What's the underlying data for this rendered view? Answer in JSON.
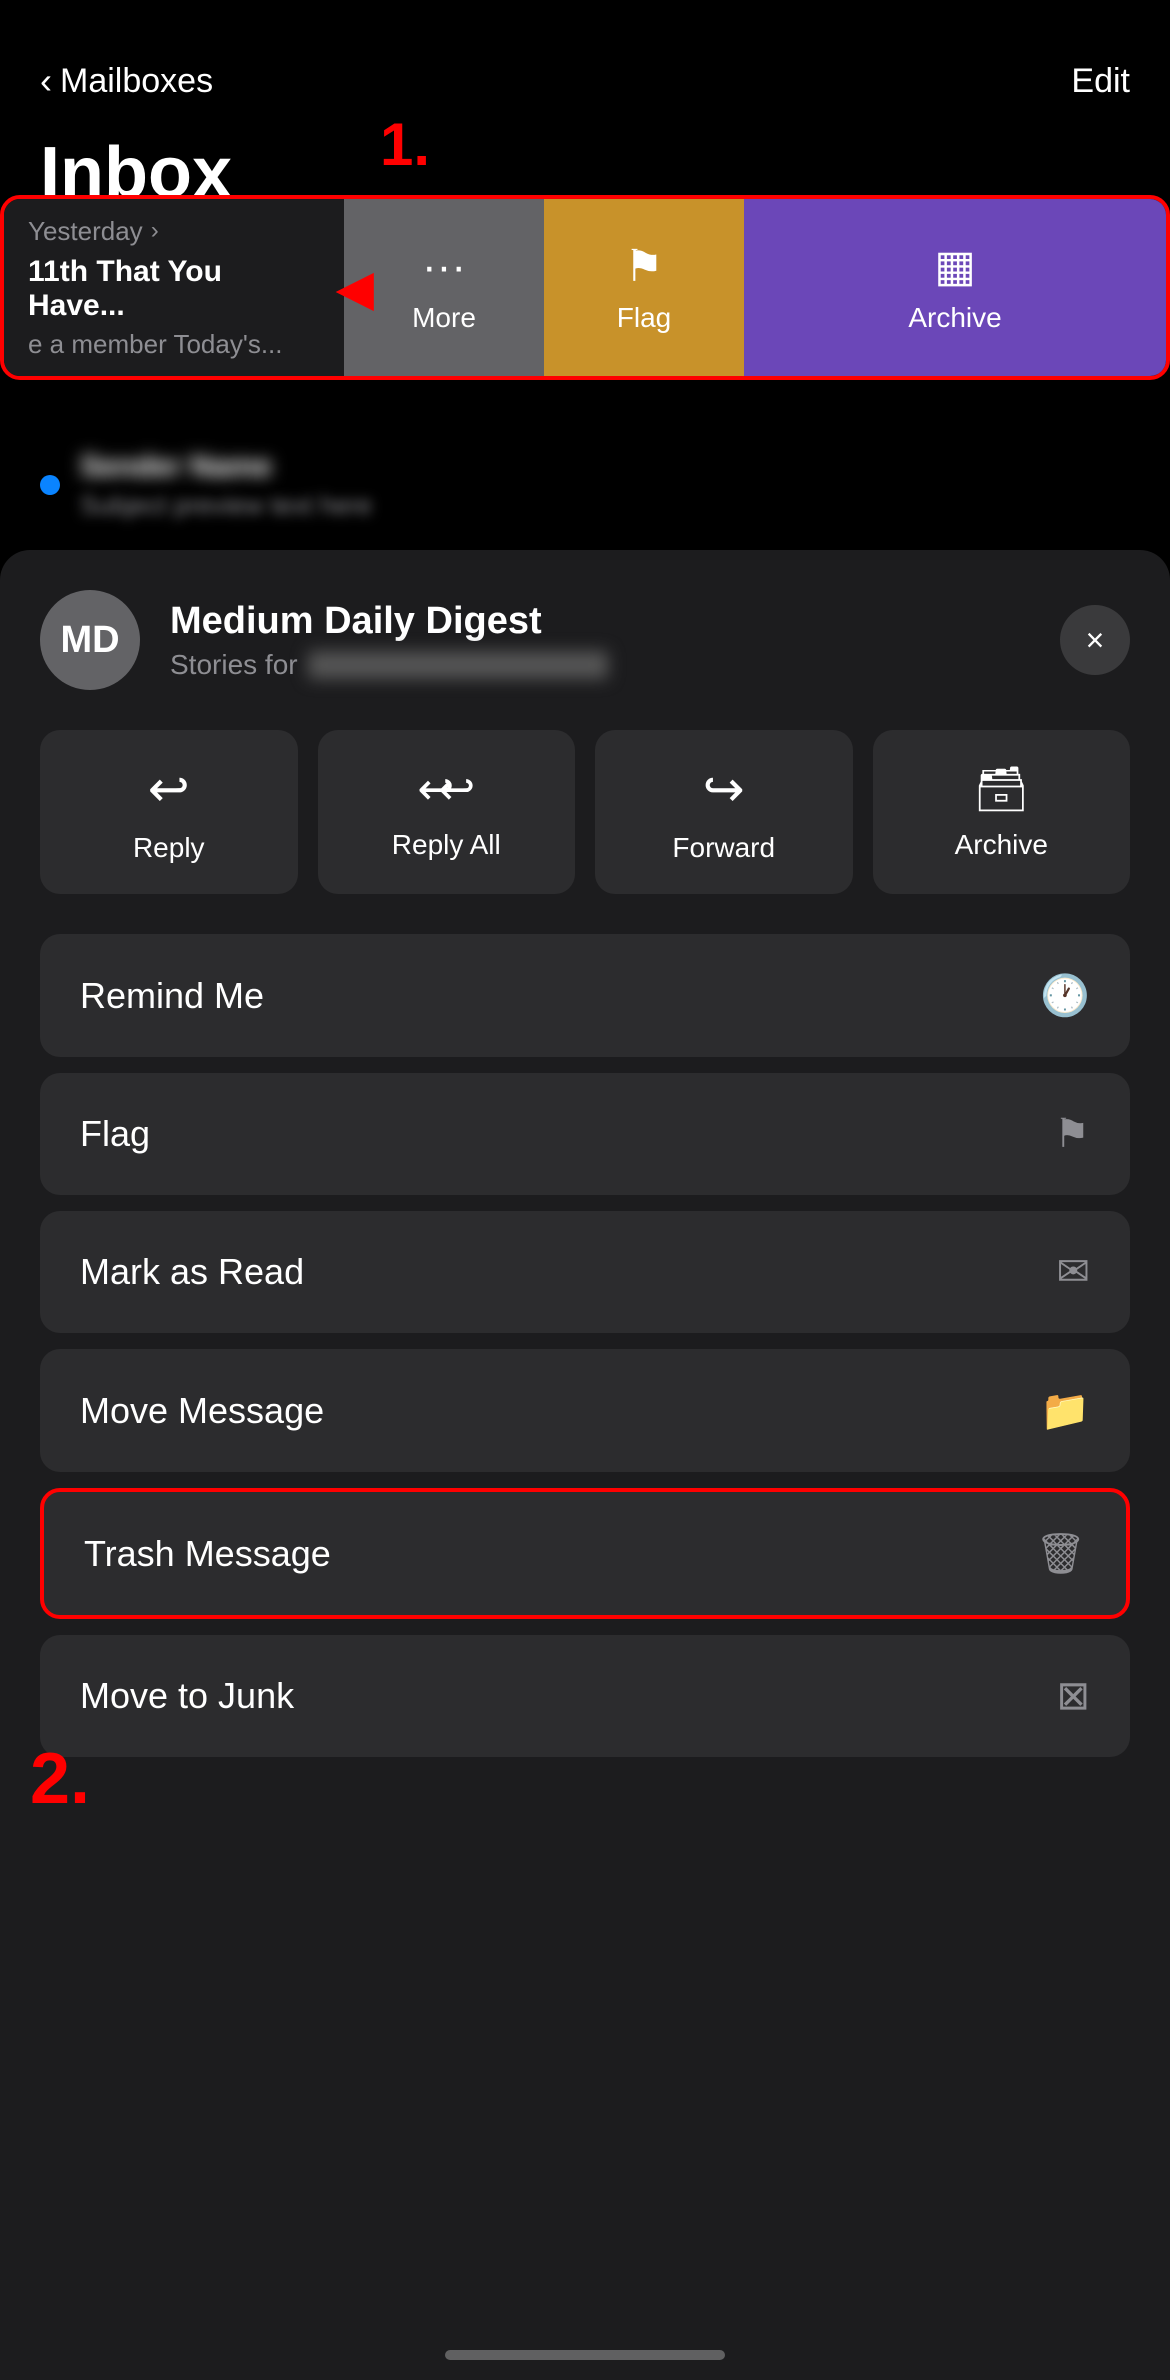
{
  "nav": {
    "back_label": "Mailboxes",
    "edit_label": "Edit"
  },
  "inbox": {
    "title": "Inbox"
  },
  "step1": "1.",
  "step2": "2.",
  "email_swipe": {
    "date": "Yesterday",
    "subject": "11th That You Have...",
    "preview": "e a member Today's...",
    "actions": {
      "more": "More",
      "flag": "Flag",
      "archive": "Archive"
    }
  },
  "bottom_sheet": {
    "avatar_initials": "MD",
    "sender_name": "Medium Daily Digest",
    "subject_prefix": "Stories for",
    "close_icon": "×",
    "action_buttons": [
      {
        "label": "Reply",
        "icon": "↩"
      },
      {
        "label": "Reply All",
        "icon": "↩↩"
      },
      {
        "label": "Forward",
        "icon": "↪"
      },
      {
        "label": "Archive",
        "icon": "🗄"
      }
    ],
    "list_actions": [
      {
        "label": "Remind Me",
        "icon": "🕐"
      },
      {
        "label": "Flag",
        "icon": "🏴"
      },
      {
        "label": "Mark as Read",
        "icon": "✉"
      },
      {
        "label": "Move Message",
        "icon": "📁"
      },
      {
        "label": "Trash Message",
        "icon": "🗑",
        "highlighted": true
      },
      {
        "label": "Move to Junk",
        "icon": "⊠"
      }
    ]
  }
}
